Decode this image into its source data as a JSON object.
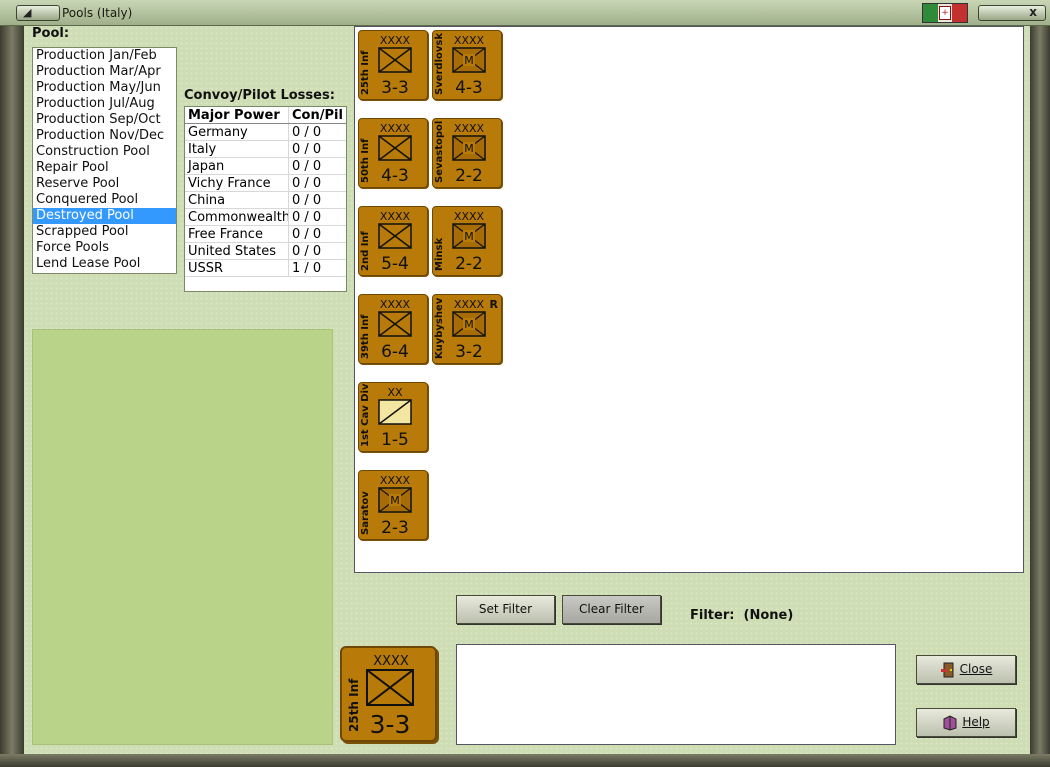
{
  "window": {
    "title": "Pools (Italy)",
    "close_glyph": "x"
  },
  "pool": {
    "label": "Pool:",
    "items": [
      "Production Jan/Feb",
      "Production Mar/Apr",
      "Production May/Jun",
      "Production Jul/Aug",
      "Production Sep/Oct",
      "Production Nov/Dec",
      "Construction Pool",
      "Repair Pool",
      "Reserve Pool",
      "Conquered Pool",
      "Destroyed Pool",
      "Scrapped Pool",
      "Force Pools",
      "Lend Lease Pool"
    ],
    "selected_index": 10
  },
  "losses": {
    "label": "Convoy/Pilot Losses:",
    "headers": [
      "Major Power",
      "Con/Pil"
    ],
    "rows": [
      [
        "Germany",
        "0 / 0"
      ],
      [
        "Italy",
        "0 / 0"
      ],
      [
        "Japan",
        "0 / 0"
      ],
      [
        "Vichy France",
        "0 / 0"
      ],
      [
        "China",
        "0 / 0"
      ],
      [
        "Commonwealth",
        "0 / 0"
      ],
      [
        "Free France",
        "0 / 0"
      ],
      [
        "United States",
        "0 / 0"
      ],
      [
        "USSR",
        "1 / 0"
      ]
    ]
  },
  "units": [
    {
      "name": "25th Inf",
      "size": "XXXX",
      "type": "infantry",
      "strength": "3-3",
      "reserve": ""
    },
    {
      "name": "Sverdlovsk",
      "size": "XXXX",
      "type": "militia",
      "strength": "4-3",
      "reserve": ""
    },
    {
      "name": "50th Inf",
      "size": "XXXX",
      "type": "infantry",
      "strength": "4-3",
      "reserve": ""
    },
    {
      "name": "Sevastopol",
      "size": "XXXX",
      "type": "militia",
      "strength": "2-2",
      "reserve": ""
    },
    {
      "name": "2nd Inf",
      "size": "XXXX",
      "type": "infantry",
      "strength": "5-4",
      "reserve": ""
    },
    {
      "name": "Minsk",
      "size": "XXXX",
      "type": "militia",
      "strength": "2-2",
      "reserve": ""
    },
    {
      "name": "39th Inf",
      "size": "XXXX",
      "type": "infantry",
      "strength": "6-4",
      "reserve": ""
    },
    {
      "name": "Kuybyshev",
      "size": "XXXX",
      "type": "militia",
      "strength": "3-2",
      "reserve": "R"
    },
    {
      "name": "1st Cav Div",
      "size": "XX",
      "type": "cavalry",
      "strength": "1-5",
      "reserve": ""
    },
    {
      "name": "Saratov",
      "size": "XXXX",
      "type": "militia",
      "strength": "2-3",
      "reserve": ""
    }
  ],
  "selected_unit": {
    "name": "25th Inf",
    "size": "XXXX",
    "type": "infantry",
    "strength": "3-3"
  },
  "filter": {
    "set_label": "Set Filter",
    "clear_label": "Clear Filter",
    "label": "Filter:",
    "value": "(None)"
  },
  "buttons": {
    "close_label": "Close",
    "help_label": "Help"
  },
  "colors": {
    "counter": "#b87a08",
    "selected": "#3399ff",
    "panel": "#cfddb5",
    "green_box": "#b9d488"
  }
}
